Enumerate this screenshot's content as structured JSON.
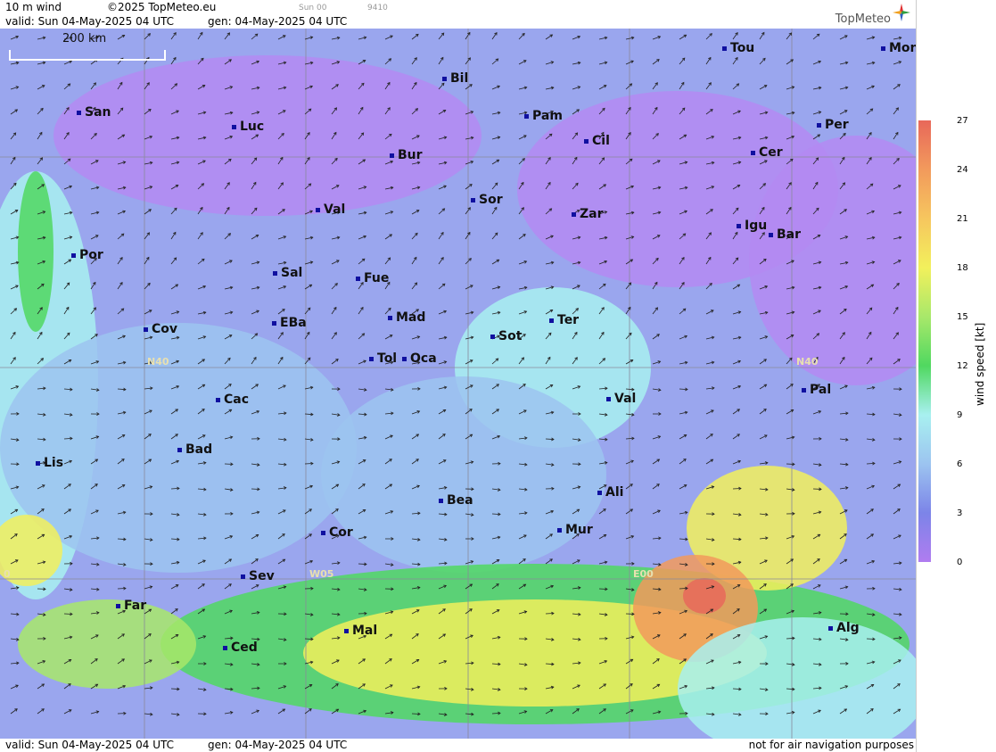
{
  "header": {
    "product": "10 m wind",
    "copyright": "©2025 TopMeteo.eu",
    "run_label": "Sun 00",
    "code": "9410",
    "valid": "valid:  Sun  04-May-2025  04 UTC",
    "gen": "gen: 04-May-2025 04 UTC",
    "brand": "TopMeteo"
  },
  "footer": {
    "valid": "valid:  Sun  04-May-2025  04 UTC",
    "gen": "gen: 04-May-2025 04 UTC",
    "disclaimer": "not for air navigation purposes"
  },
  "scale_bar": "200 km",
  "grid_labels": {
    "n40_left": "N40",
    "n40_right": "N40",
    "w05": "W05",
    "e00": "E00",
    "zero": "0"
  },
  "cities": [
    {
      "name": "Bil"
    },
    {
      "name": "Tou"
    },
    {
      "name": "Mon"
    },
    {
      "name": "San"
    },
    {
      "name": "Luc"
    },
    {
      "name": "Pam"
    },
    {
      "name": "Cil"
    },
    {
      "name": "Per"
    },
    {
      "name": "Bur"
    },
    {
      "name": "Cer"
    },
    {
      "name": "Sor"
    },
    {
      "name": "Val"
    },
    {
      "name": "Zar"
    },
    {
      "name": "Igu"
    },
    {
      "name": "Bar"
    },
    {
      "name": "Por"
    },
    {
      "name": "Sal"
    },
    {
      "name": "Fue"
    },
    {
      "name": "Mad"
    },
    {
      "name": "Cov"
    },
    {
      "name": "EBa"
    },
    {
      "name": "Ter"
    },
    {
      "name": "Sot"
    },
    {
      "name": "Tol"
    },
    {
      "name": "Oca"
    },
    {
      "name": "Pal"
    },
    {
      "name": "Cac"
    },
    {
      "name": "Val"
    },
    {
      "name": "Bad"
    },
    {
      "name": "Lis"
    },
    {
      "name": "Ali"
    },
    {
      "name": "Bea"
    },
    {
      "name": "Mur"
    },
    {
      "name": "Cor"
    },
    {
      "name": "Sev"
    },
    {
      "name": "Far"
    },
    {
      "name": "Alg"
    },
    {
      "name": "Mal"
    },
    {
      "name": "Ced"
    }
  ],
  "legend": {
    "title": "wind speed  [kt]",
    "ticks": [
      "27",
      "24",
      "21",
      "18",
      "15",
      "12",
      "9",
      "6",
      "3",
      "0"
    ],
    "colors": [
      "#e8685a",
      "#f29a5c",
      "#f6c65e",
      "#f2f05c",
      "#a8e86a",
      "#50d860",
      "#a8f0f0",
      "#9cc4f0",
      "#7c84e8",
      "#b07cf0"
    ]
  }
}
